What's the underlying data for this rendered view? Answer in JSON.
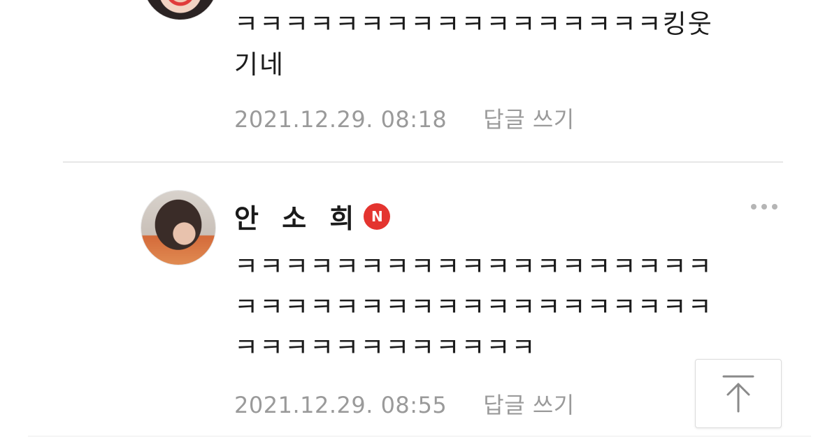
{
  "comment1": {
    "text_line1": "ㅋㅋㅋㅋㅋㅋㅋㅋㅋㅋㅋㅋㅋㅋㅋㅋㅋ킹웃",
    "text_line2": "기네",
    "timestamp": "2021.12.29. 08:18",
    "reply_label": "답글 쓰기"
  },
  "comment2": {
    "author": "안 소 희",
    "badge": "N",
    "badge_color": "#e4342f",
    "text_line1": "ㅋㅋㅋㅋㅋㅋㅋㅋㅋㅋㅋㅋㅋㅋㅋㅋㅋㅋㅋ",
    "text_line2": "ㅋㅋㅋㅋㅋㅋㅋㅋㅋㅋㅋㅋㅋㅋㅋㅋㅋㅋㅋ",
    "text_line3": "ㅋㅋㅋㅋㅋㅋㅋㅋㅋㅋㅋㅋ",
    "timestamp": "2021.12.29. 08:55",
    "reply_label": "답글 쓰기"
  },
  "icons": {
    "more": "more-icon",
    "scroll_top": "arrow-up-icon"
  }
}
